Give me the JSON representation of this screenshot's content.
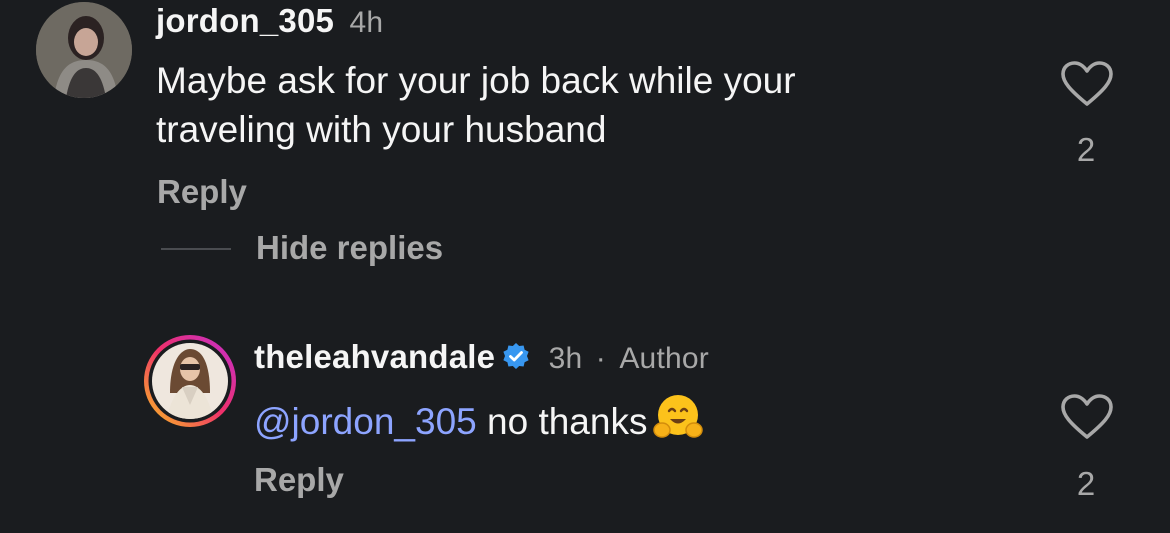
{
  "comments": [
    {
      "username": "jordon_305",
      "time": "4h",
      "text_line1": "Maybe ask for your job back while your",
      "text_line2": "traveling with your husband",
      "reply_label": "Reply",
      "like_count": "2",
      "avatar_icon": "user-avatar"
    }
  ],
  "thread": {
    "hide_replies_label": "Hide replies"
  },
  "replies": [
    {
      "username": "theleahvandale",
      "verified_icon": "verified-badge-icon",
      "time": "3h",
      "separator": "·",
      "author_label": "Author",
      "mention": "@jordon_305",
      "text": " no thanks",
      "emoji": "hugging-face",
      "reply_label": "Reply",
      "like_count": "2",
      "avatar_icon": "user-avatar-story-ring"
    }
  ],
  "colors": {
    "background": "#1a1c1f",
    "text": "#f5f5f5",
    "secondary": "#a8a8a8",
    "mention": "#8da4ff",
    "verified": "#3897f0"
  }
}
